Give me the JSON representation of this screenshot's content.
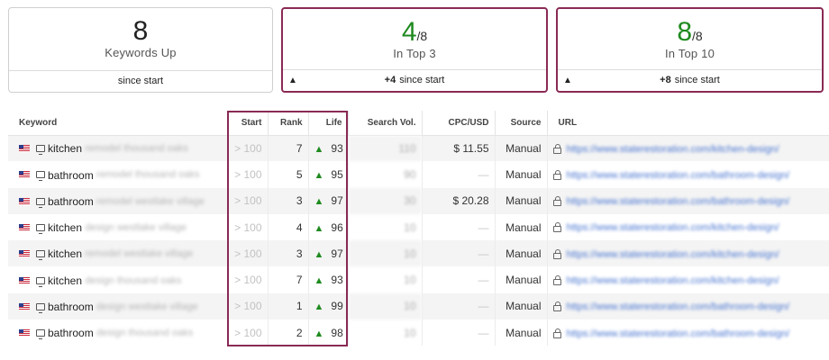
{
  "cards": [
    {
      "number": "8",
      "denominator": "",
      "label": "Keywords Up",
      "footer_bold": "",
      "footer_text": "since start"
    },
    {
      "number": "4",
      "denominator": "/8",
      "label": "In Top 3",
      "footer_bold": "+4",
      "footer_text": "since start"
    },
    {
      "number": "8",
      "denominator": "/8",
      "label": "In Top 10",
      "footer_bold": "+8",
      "footer_text": "since start"
    }
  ],
  "colors": {
    "accent_border": "#8a2a55",
    "positive": "#1f8a1f",
    "link": "#4a76d1"
  },
  "table": {
    "headers": [
      "Keyword",
      "Start",
      "Rank",
      "Life",
      "Search Vol.",
      "CPC/USD",
      "Source",
      "URL"
    ],
    "rows": [
      {
        "kw": "kitchen",
        "kw_rest": "remodel thousand oaks",
        "start": "> 100",
        "rank": "7",
        "life": "93",
        "vol": "110",
        "cpc": "$ 11.55",
        "source": "Manual",
        "url": "https://www.staterestoration.com/kitchen-design/"
      },
      {
        "kw": "bathroom",
        "kw_rest": "remodel thousand oaks",
        "start": "> 100",
        "rank": "5",
        "life": "95",
        "vol": "90",
        "cpc": "—",
        "source": "Manual",
        "url": "https://www.staterestoration.com/bathroom-design/"
      },
      {
        "kw": "bathroom",
        "kw_rest": "remodel westlake village",
        "start": "> 100",
        "rank": "3",
        "life": "97",
        "vol": "30",
        "cpc": "$ 20.28",
        "source": "Manual",
        "url": "https://www.staterestoration.com/bathroom-design/"
      },
      {
        "kw": "kitchen",
        "kw_rest": "design westlake village",
        "start": "> 100",
        "rank": "4",
        "life": "96",
        "vol": "10",
        "cpc": "—",
        "source": "Manual",
        "url": "https://www.staterestoration.com/kitchen-design/"
      },
      {
        "kw": "kitchen",
        "kw_rest": "remodel westlake village",
        "start": "> 100",
        "rank": "3",
        "life": "97",
        "vol": "10",
        "cpc": "—",
        "source": "Manual",
        "url": "https://www.staterestoration.com/kitchen-design/"
      },
      {
        "kw": "kitchen",
        "kw_rest": "design thousand oaks",
        "start": "> 100",
        "rank": "7",
        "life": "93",
        "vol": "10",
        "cpc": "—",
        "source": "Manual",
        "url": "https://www.staterestoration.com/kitchen-design/"
      },
      {
        "kw": "bathroom",
        "kw_rest": "design westlake village",
        "start": "> 100",
        "rank": "1",
        "life": "99",
        "vol": "10",
        "cpc": "—",
        "source": "Manual",
        "url": "https://www.staterestoration.com/bathroom-design/"
      },
      {
        "kw": "bathroom",
        "kw_rest": "design thousand oaks",
        "start": "> 100",
        "rank": "2",
        "life": "98",
        "vol": "10",
        "cpc": "—",
        "source": "Manual",
        "url": "https://www.staterestoration.com/bathroom-design/"
      }
    ]
  }
}
